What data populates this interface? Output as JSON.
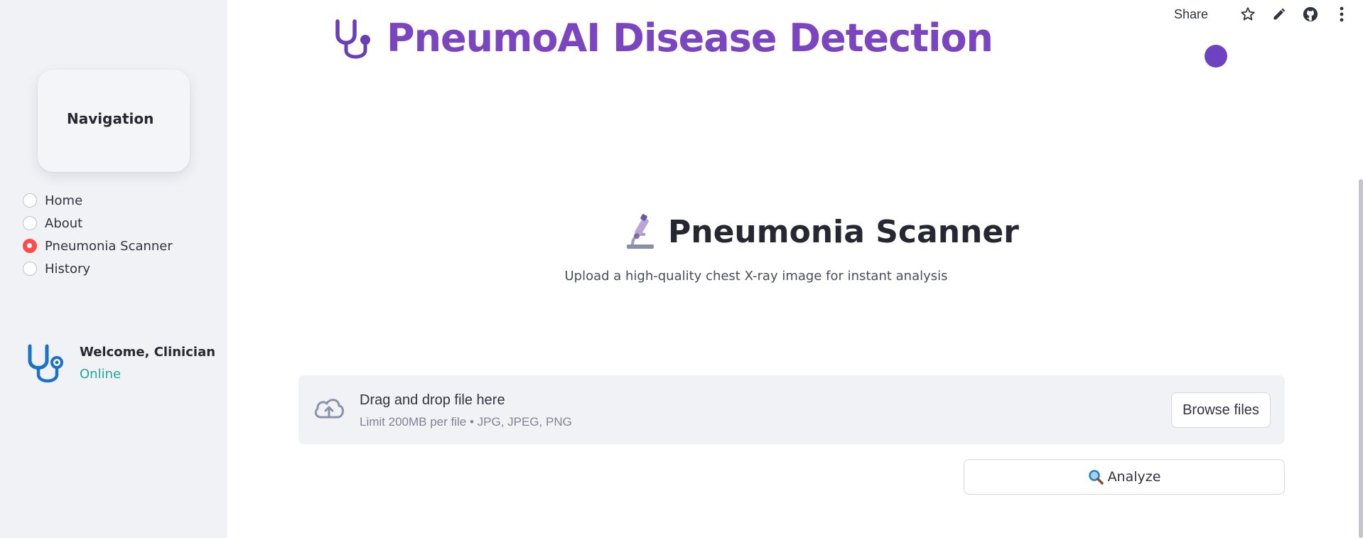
{
  "header": {
    "title": "PneumoAI Disease Detection",
    "title_icon": "stethoscope-icon",
    "toolbar": {
      "share_label": "Share",
      "icons": [
        "star-icon",
        "edit-pencil-icon",
        "github-icon",
        "more-vertical-icon"
      ]
    }
  },
  "sidebar": {
    "nav_title": "Navigation",
    "items": [
      {
        "label": "Home",
        "selected": false
      },
      {
        "label": "About",
        "selected": false
      },
      {
        "label": "Pneumonia Scanner",
        "selected": true
      },
      {
        "label": "History",
        "selected": false
      }
    ],
    "user": {
      "icon": "stethoscope-icon",
      "name": "Welcome, Clinician",
      "status": "Online"
    }
  },
  "main": {
    "scanner_title": "Pneumonia Scanner",
    "scanner_icon": "microscope-icon",
    "scanner_subtitle": "Upload a high-quality chest X-ray image for instant analysis",
    "uploader": {
      "drop_text": "Drag and drop file here",
      "limit_text": "Limit 200MB per file • JPG, JPEG, PNG",
      "browse_label": "Browse files",
      "icon": "cloud-upload-icon"
    },
    "analyze_label": "Analyze",
    "analyze_icon": "magnifier-icon"
  },
  "colors": {
    "title_purple": "#7b45c0",
    "radio_selected": "#ff4b4b",
    "status_online": "#21a89a",
    "sidebar_bg": "#f0f2f6",
    "accent_dot": "#6f42c1"
  }
}
